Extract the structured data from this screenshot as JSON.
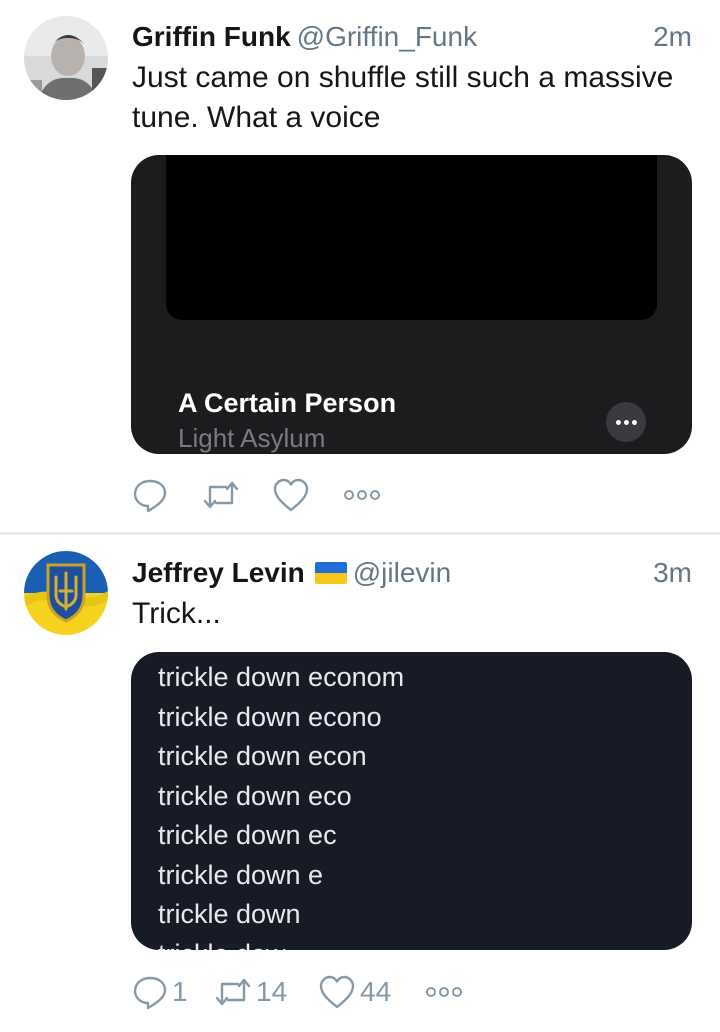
{
  "tweets": [
    {
      "name": "Griffin Funk",
      "handle": "@Griffin_Funk",
      "time": "2m",
      "text": "Just came on shuffle still such a massive tune. What a voice",
      "media": {
        "song_title": "A Certain Person",
        "song_artist": "Light Asylum"
      },
      "actions": {
        "reply": "",
        "retweet": "",
        "like": ""
      }
    },
    {
      "name": "Jeffrey Levin",
      "flag": "Ukraine flag (blue #1f6fd6 / yellow #f7c71e)",
      "handle": "@jilevin",
      "time": "3m",
      "text": "Trick...",
      "media_lines": [
        "trickle down econom",
        "trickle down econo",
        "trickle down econ",
        "trickle down eco",
        "trickle down ec",
        "trickle down e",
        "trickle down",
        "trickle dow"
      ],
      "actions": {
        "reply": "1",
        "retweet": "14",
        "like": "44"
      }
    }
  ],
  "colors": {
    "text": "#14171a",
    "secondary": "#657786",
    "icon": "#8899a6",
    "divider": "#e6ecf0",
    "media_dark": "#161b26"
  }
}
